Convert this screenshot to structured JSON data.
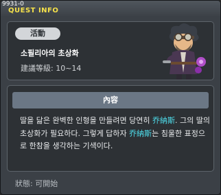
{
  "window": {
    "quest_id": "9931-0",
    "title": "QUEST INFO"
  },
  "quest": {
    "category_badge": "活動",
    "name": "소필리아의 초상화",
    "level_range": "建議等級: 10~14"
  },
  "details": {
    "header": "內容",
    "text_1": "딸을 닮은 완벽한 인형을 만들려면 당연히 ",
    "npc_1": "乔納斯",
    "text_2": ". 그의 딸의 초상화가 필요하다. 그렇게 답하자 ",
    "npc_2": "乔納斯",
    "text_3": "는 침울한 표정으로 한참을 생각하는 기색이다."
  },
  "status": {
    "label": "狀態: 可開始"
  },
  "colors": {
    "title_yellow": "#f6e24a",
    "npc_cyan": "#4fe1f0",
    "header_bar": "#6b7785"
  },
  "icons": {
    "portrait": "npc-jonas-portrait"
  }
}
